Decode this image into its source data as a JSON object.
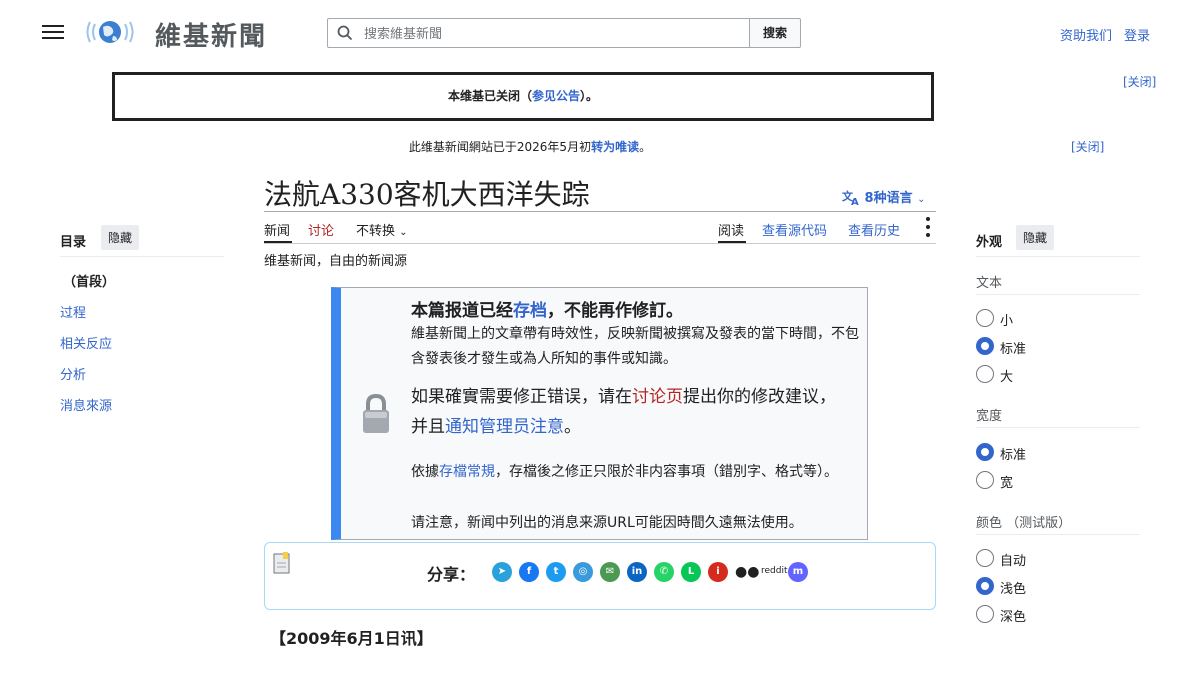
{
  "header": {
    "logo_text": "維基新聞",
    "search_placeholder": "搜索維基新聞",
    "search_button": "搜索",
    "donate": "资助我们",
    "login": "登录"
  },
  "banners": {
    "notice_prefix": "本维基已关闭（",
    "notice_link": "参见公告",
    "notice_suffix": "）。",
    "close_1": "[关闭]",
    "readonly_prefix": "此维基新闻網站已于2026年5月初",
    "readonly_link": "转为唯读",
    "readonly_suffix": "。",
    "close_2": "[关闭]"
  },
  "page": {
    "title": "法航A330客机大西洋失踪",
    "languages": "8种语言",
    "tabs": {
      "news": "新闻",
      "talk": "讨论",
      "variant": "不转换",
      "read": "阅读",
      "source": "查看源代码",
      "history": "查看历史"
    },
    "tagline": "维基新闻，自由的新闻源"
  },
  "toc": {
    "title": "目录",
    "hide": "隐藏",
    "items": [
      "（首段）",
      "过程",
      "相关反应",
      "分析",
      "消息來源"
    ]
  },
  "archive": {
    "head_prefix": "本篇报道已经",
    "head_link": "存档",
    "head_suffix": "，不能再作修訂。",
    "p1": "維基新聞上的文章帶有時效性，反映新聞被撰寫及發表的當下時間，不包含發表後才發生或為人所知的事件或知識。",
    "p2_a": "如果確實需要修正错误，请在",
    "p2_link1": "讨论页",
    "p2_b": "提出你的修改建议，并且",
    "p2_link2": "通知管理员注意",
    "p2_c": "。",
    "p3_a": "依據",
    "p3_link": "存檔常規",
    "p3_b": "，存檔後之修正只限於非内容事項（錯別字、格式等）。",
    "p4": "请注意，新闻中列出的消息来源URL可能因時間久遠無法使用。"
  },
  "share": {
    "label": "分享：",
    "reddit": "reddit"
  },
  "article": {
    "dateline": "【2009年6月1日讯】"
  },
  "appearance": {
    "title": "外观",
    "hide": "隐藏",
    "text_label": "文本",
    "text_options": [
      "小",
      "标准",
      "大"
    ],
    "width_label": "宽度",
    "width_options": [
      "标准",
      "宽"
    ],
    "color_label": "颜色 （测试版）",
    "color_options": [
      "自动",
      "浅色",
      "深色"
    ]
  },
  "colors": {
    "link": "#3366cc",
    "archive_accent": "#3a88f0",
    "talk_red": "#b32424"
  }
}
